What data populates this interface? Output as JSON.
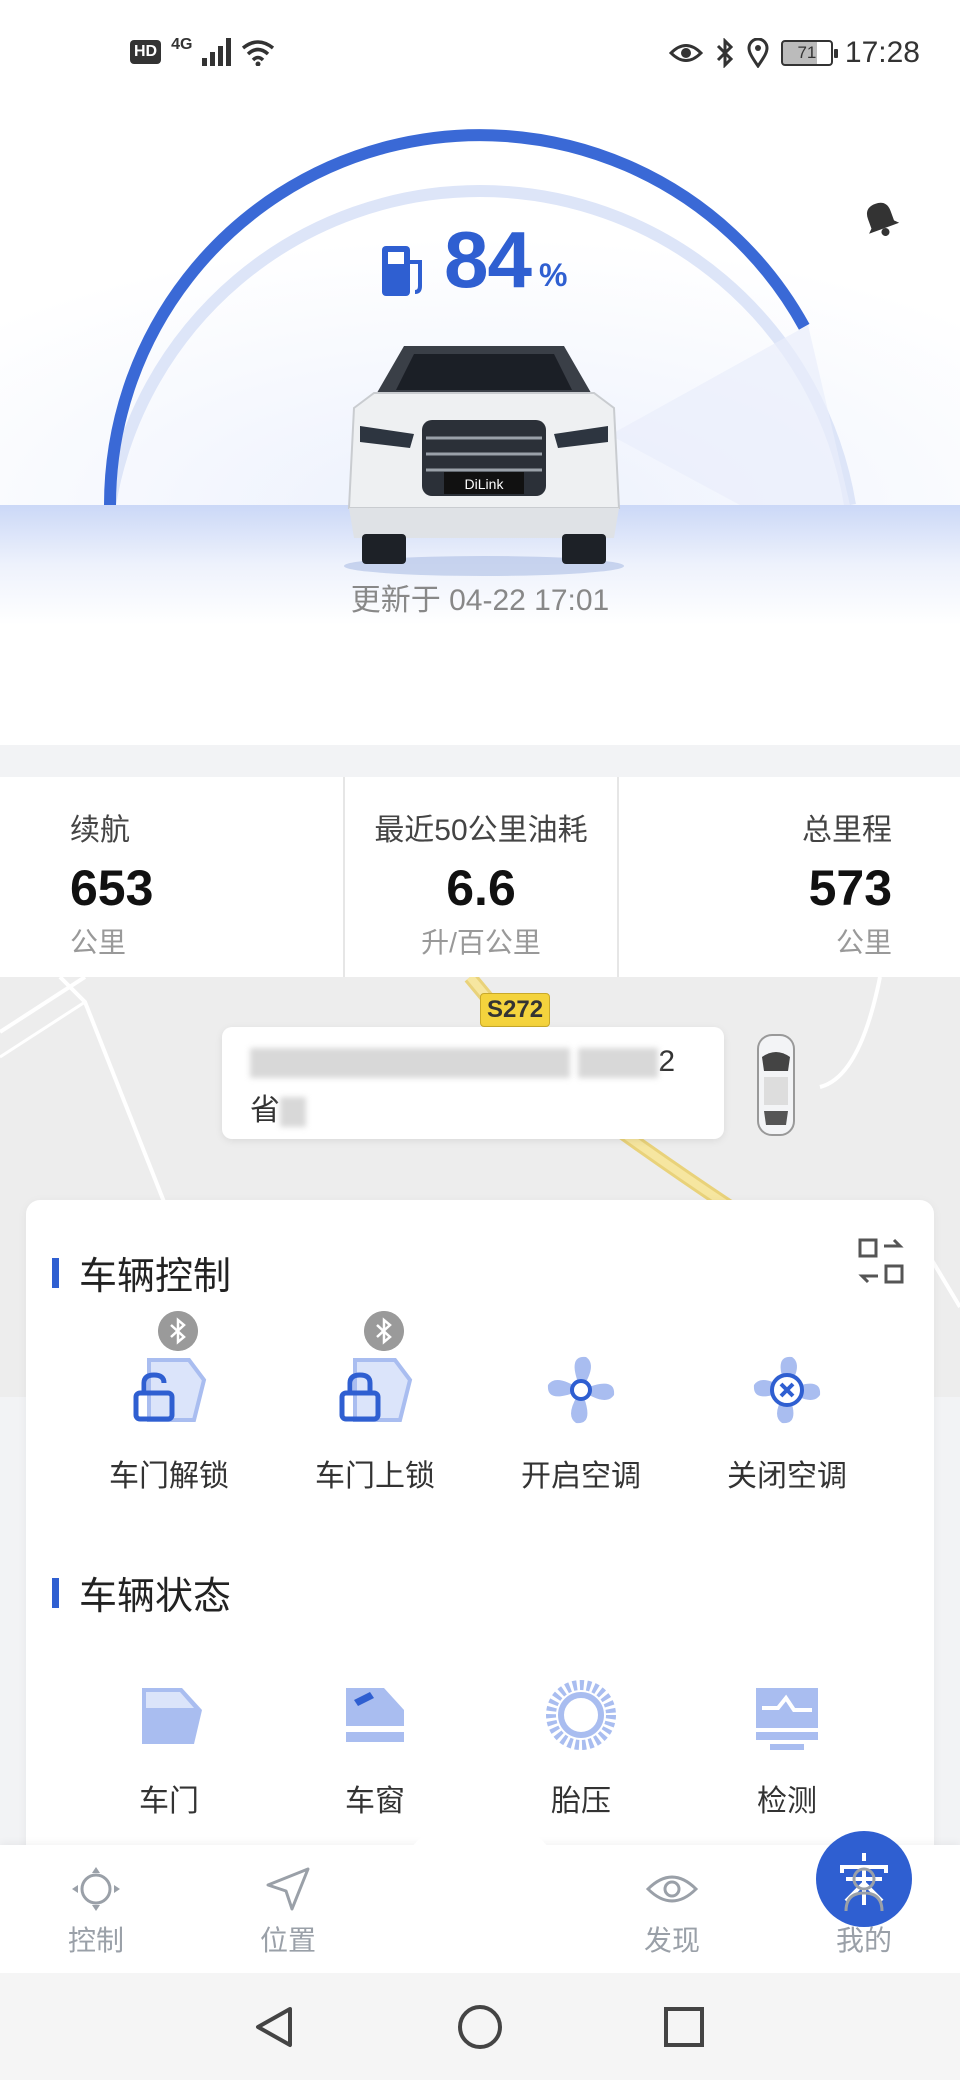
{
  "status_bar": {
    "hd": "HD",
    "network": "4G",
    "battery": "71",
    "time": "17:28"
  },
  "hero": {
    "fuel_percent": 84,
    "fuel_value": "84",
    "fuel_unit": "%",
    "plate_brand": "DiLink",
    "update_text": "更新于 04-22 17:01"
  },
  "stats": [
    {
      "label": "续航",
      "value": "653",
      "unit": "公里"
    },
    {
      "label": "最近50公里油耗",
      "value": "6.6",
      "unit": "升/百公里"
    },
    {
      "label": "总里程",
      "value": "573",
      "unit": "公里"
    }
  ],
  "map": {
    "road_tag": "S272",
    "address_tail": "2",
    "address_line2_start": "省"
  },
  "vehicle_control": {
    "title": "车辆控制",
    "items": [
      {
        "label": "车门解锁",
        "icon": "door-unlock-icon",
        "bluetooth": true
      },
      {
        "label": "车门上锁",
        "icon": "door-lock-icon",
        "bluetooth": true
      },
      {
        "label": "开启空调",
        "icon": "fan-on-icon",
        "bluetooth": false
      },
      {
        "label": "关闭空调",
        "icon": "fan-off-icon",
        "bluetooth": false
      }
    ]
  },
  "vehicle_status": {
    "title": "车辆状态",
    "items": [
      {
        "label": "车门",
        "icon": "door-icon"
      },
      {
        "label": "车窗",
        "icon": "window-icon"
      },
      {
        "label": "胎压",
        "icon": "tire-icon"
      },
      {
        "label": "检测",
        "icon": "diagnose-icon"
      }
    ]
  },
  "tabbar": {
    "tabs": [
      {
        "label": "控制",
        "icon": "control-icon"
      },
      {
        "label": "位置",
        "icon": "location-icon"
      },
      {
        "label": "",
        "icon": "song-logo-icon"
      },
      {
        "label": "发现",
        "icon": "eye-icon"
      },
      {
        "label": "我的",
        "icon": "user-icon"
      }
    ],
    "center_char": "宋"
  },
  "colors": {
    "accent": "#2f5fd1",
    "accent_light": "#a9bdf0",
    "text_gray": "#888888"
  }
}
